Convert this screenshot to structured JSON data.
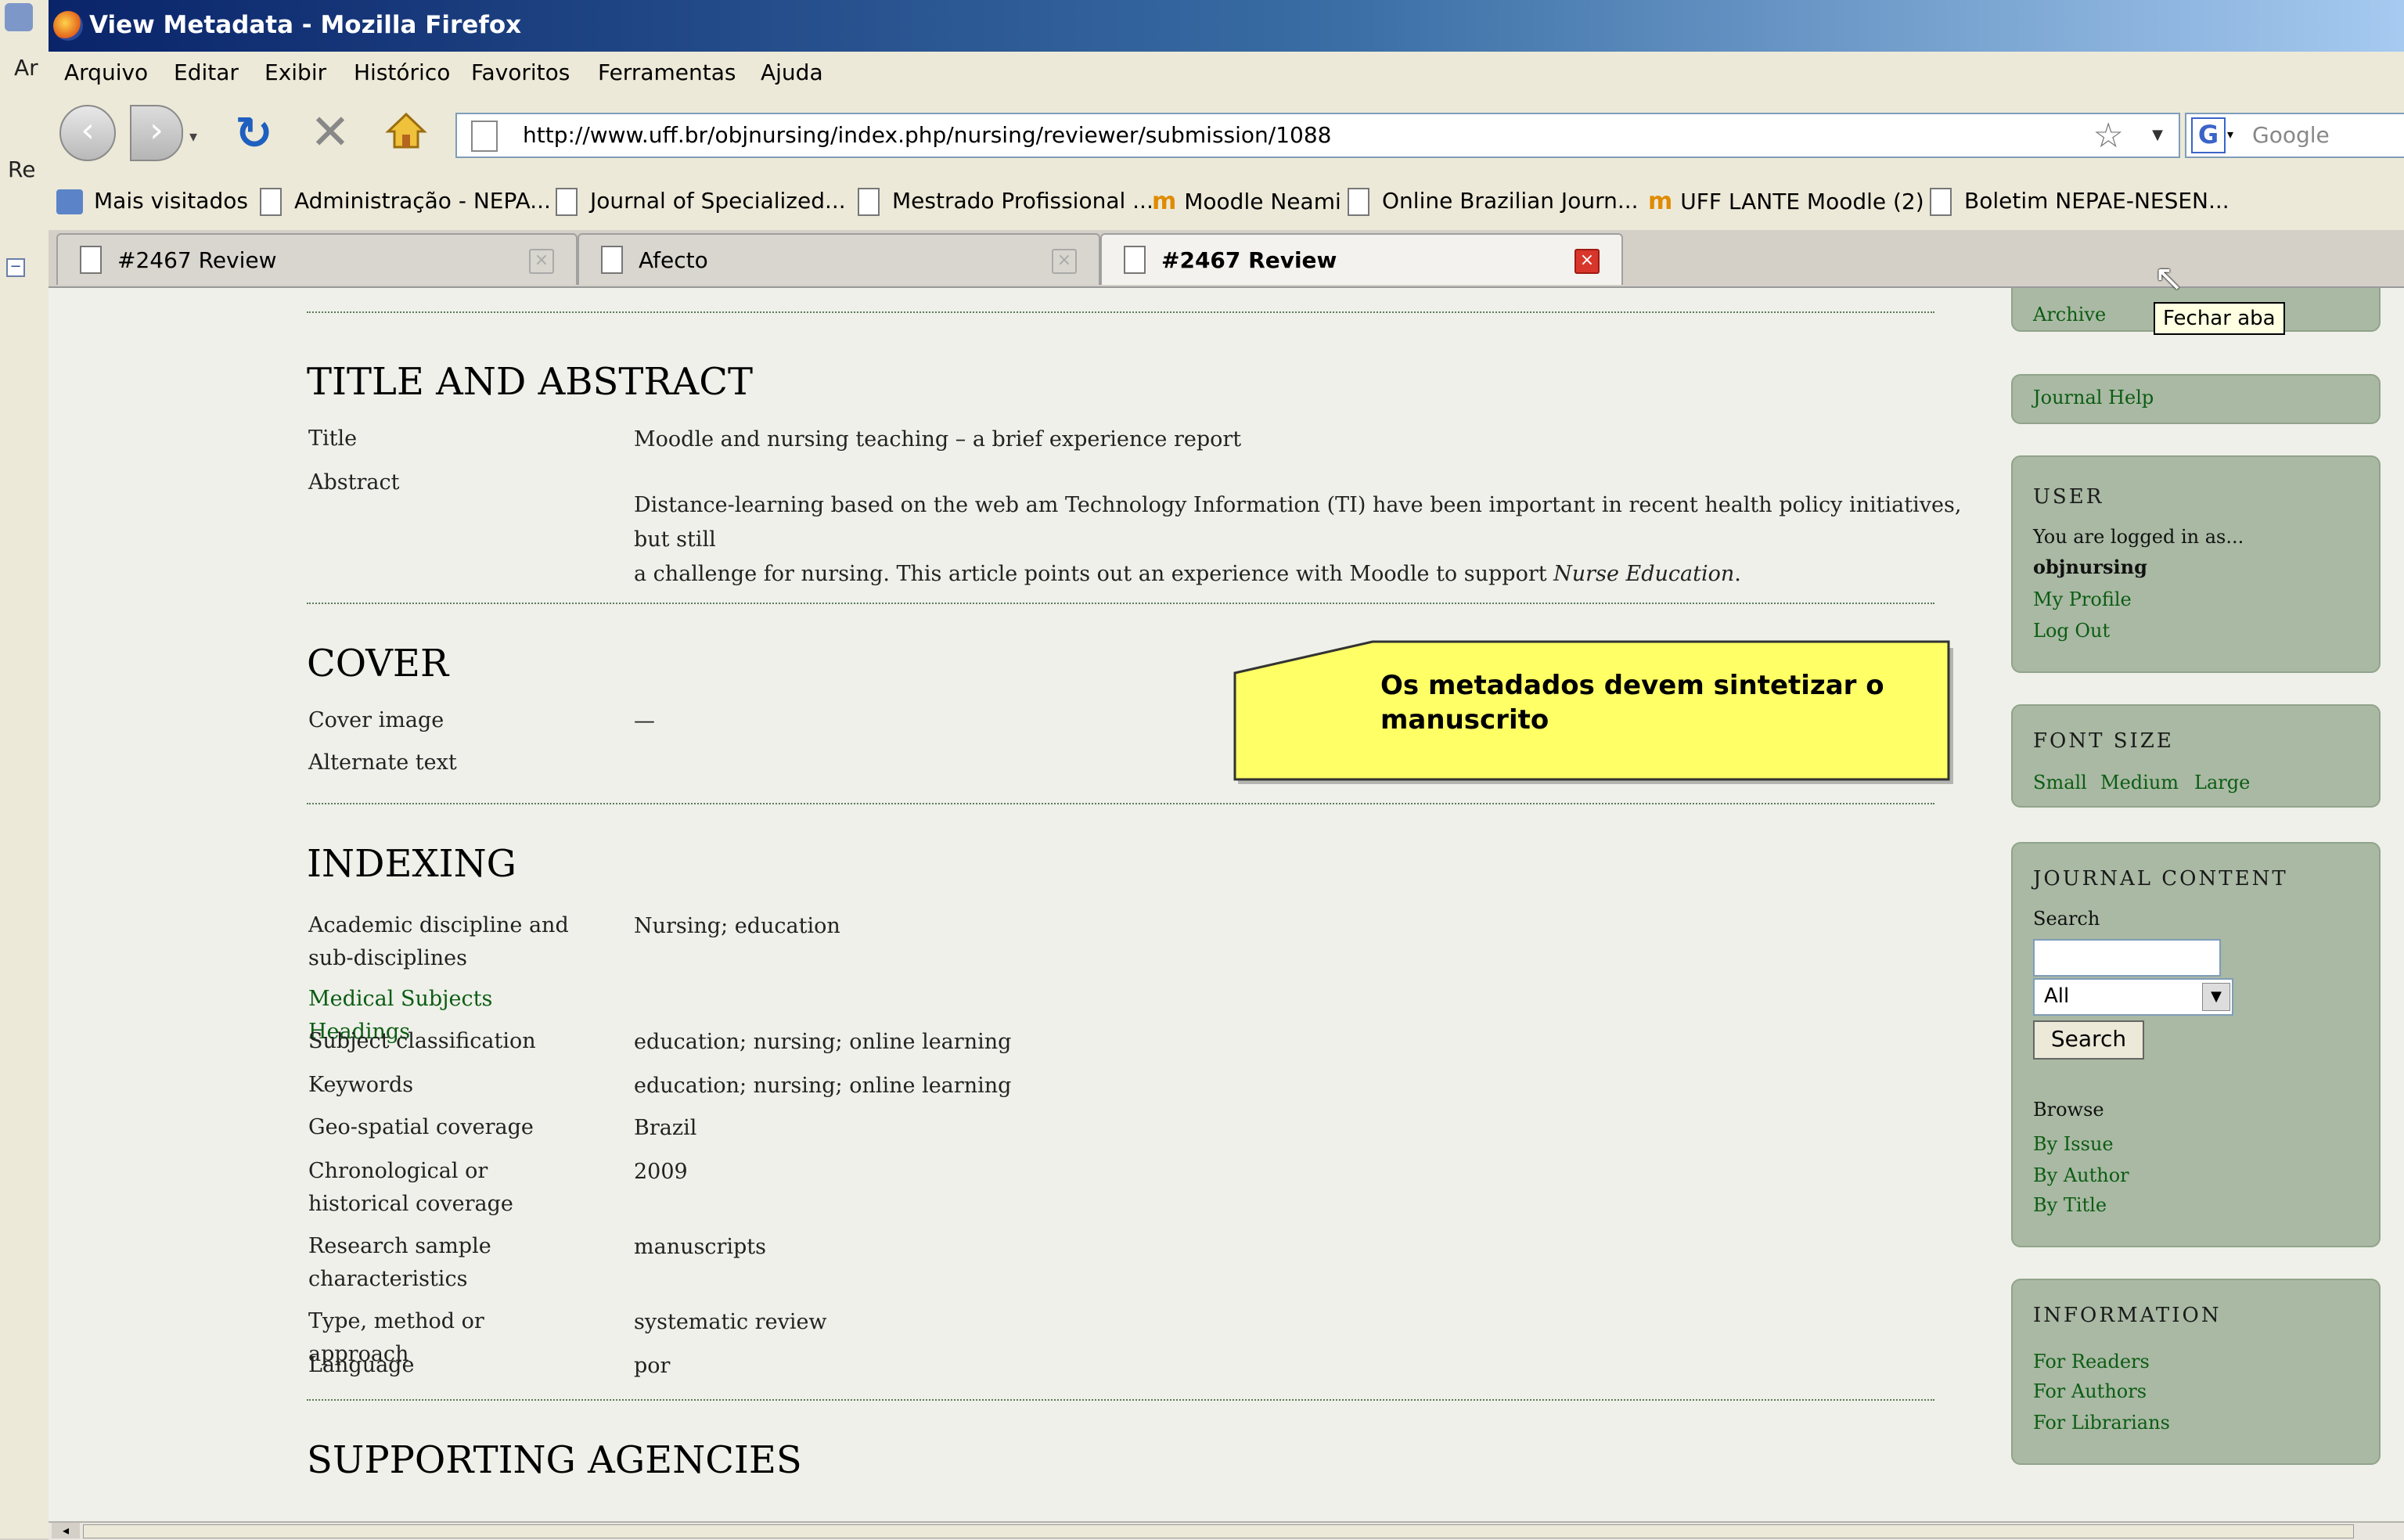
{
  "desktop": {
    "text1": "Ar",
    "text2": "Re",
    "tree_toggle": "−"
  },
  "window": {
    "title": "View Metadata - Mozilla Firefox"
  },
  "menu": [
    "Arquivo",
    "Editar",
    "Exibir",
    "Histórico",
    "Favoritos",
    "Ferramentas",
    "Ajuda"
  ],
  "nav": {
    "url": "http://www.uff.br/objnursing/index.php/nursing/reviewer/submission/1088",
    "search_placeholder": "Google"
  },
  "bookmarks": [
    "Mais visitados",
    "Administração - NEPA...",
    "Journal of Specialized...",
    "Mestrado Profissional ...",
    "Moodle Neami",
    "Online Brazilian Journ...",
    "UFF LANTE Moodle (2)",
    "Boletim NEPAE-NESEN..."
  ],
  "tabs": [
    "#2467 Review",
    "Afecto",
    "#2467 Review"
  ],
  "tooltip": "Fechar aba",
  "content": {
    "title_abstract": {
      "heading": "TITLE AND ABSTRACT",
      "title_label": "Title",
      "title_value": "Moodle and nursing teaching – a brief experience report",
      "abstract_label": "Abstract",
      "abstract_line1": "Distance-learning based on the web am Technology Information (TI) have  been important in recent health policy initiatives, but still",
      "abstract_line2_pre": "a challenge for nursing. This article points out an experience with Moodle to support ",
      "abstract_line2_em": "Nurse Education",
      "abstract_line2_post": "."
    },
    "cover": {
      "heading": "COVER",
      "cover_image_label": "Cover image",
      "cover_image_value": "—",
      "alternate_text_label": "Alternate text"
    },
    "indexing": {
      "heading": "INDEXING",
      "rows": [
        {
          "label": "Academic discipline and sub-disciplines",
          "value": "Nursing; education"
        },
        {
          "label": "Medical Subjects Headings",
          "value": ""
        },
        {
          "label": "Subject classification",
          "value": "education; nursing; online learning"
        },
        {
          "label": "Keywords",
          "value": "education; nursing; online learning"
        },
        {
          "label": "Geo-spatial coverage",
          "value": "Brazil"
        },
        {
          "label": "Chronological or historical coverage",
          "value": "2009"
        },
        {
          "label": "Research sample characteristics",
          "value": "manuscripts"
        },
        {
          "label": "Type, method or approach",
          "value": "systematic review"
        },
        {
          "label": "Language",
          "value": "por"
        }
      ]
    },
    "supporting": {
      "heading": "SUPPORTING AGENCIES"
    }
  },
  "callout": {
    "text": "Os metadados devem sintetizar o manuscrito"
  },
  "sidebar": {
    "archive": "Archive",
    "journal_help": "Journal Help",
    "user": {
      "heading": "USER",
      "logged": "You are logged in as...",
      "username": "objnursing",
      "profile": "My Profile",
      "logout": "Log Out"
    },
    "font_size": {
      "heading": "FONT SIZE",
      "small": "Small",
      "medium": "Medium",
      "large": "Large"
    },
    "journal_content": {
      "heading": "JOURNAL CONTENT",
      "search_label": "Search",
      "select_value": "All",
      "search_button": "Search",
      "browse": "Browse",
      "by_issue": "By Issue",
      "by_author": "By Author",
      "by_title": "By Title"
    },
    "information": {
      "heading": "INFORMATION",
      "readers": "For Readers",
      "authors": "For Authors",
      "librarians": "For Librarians"
    }
  },
  "colors": {
    "sidebar_bg": "#a9b9a3",
    "link": "#0c5c14",
    "page_bg": "#eef0e9",
    "callout": "#ffff66"
  }
}
